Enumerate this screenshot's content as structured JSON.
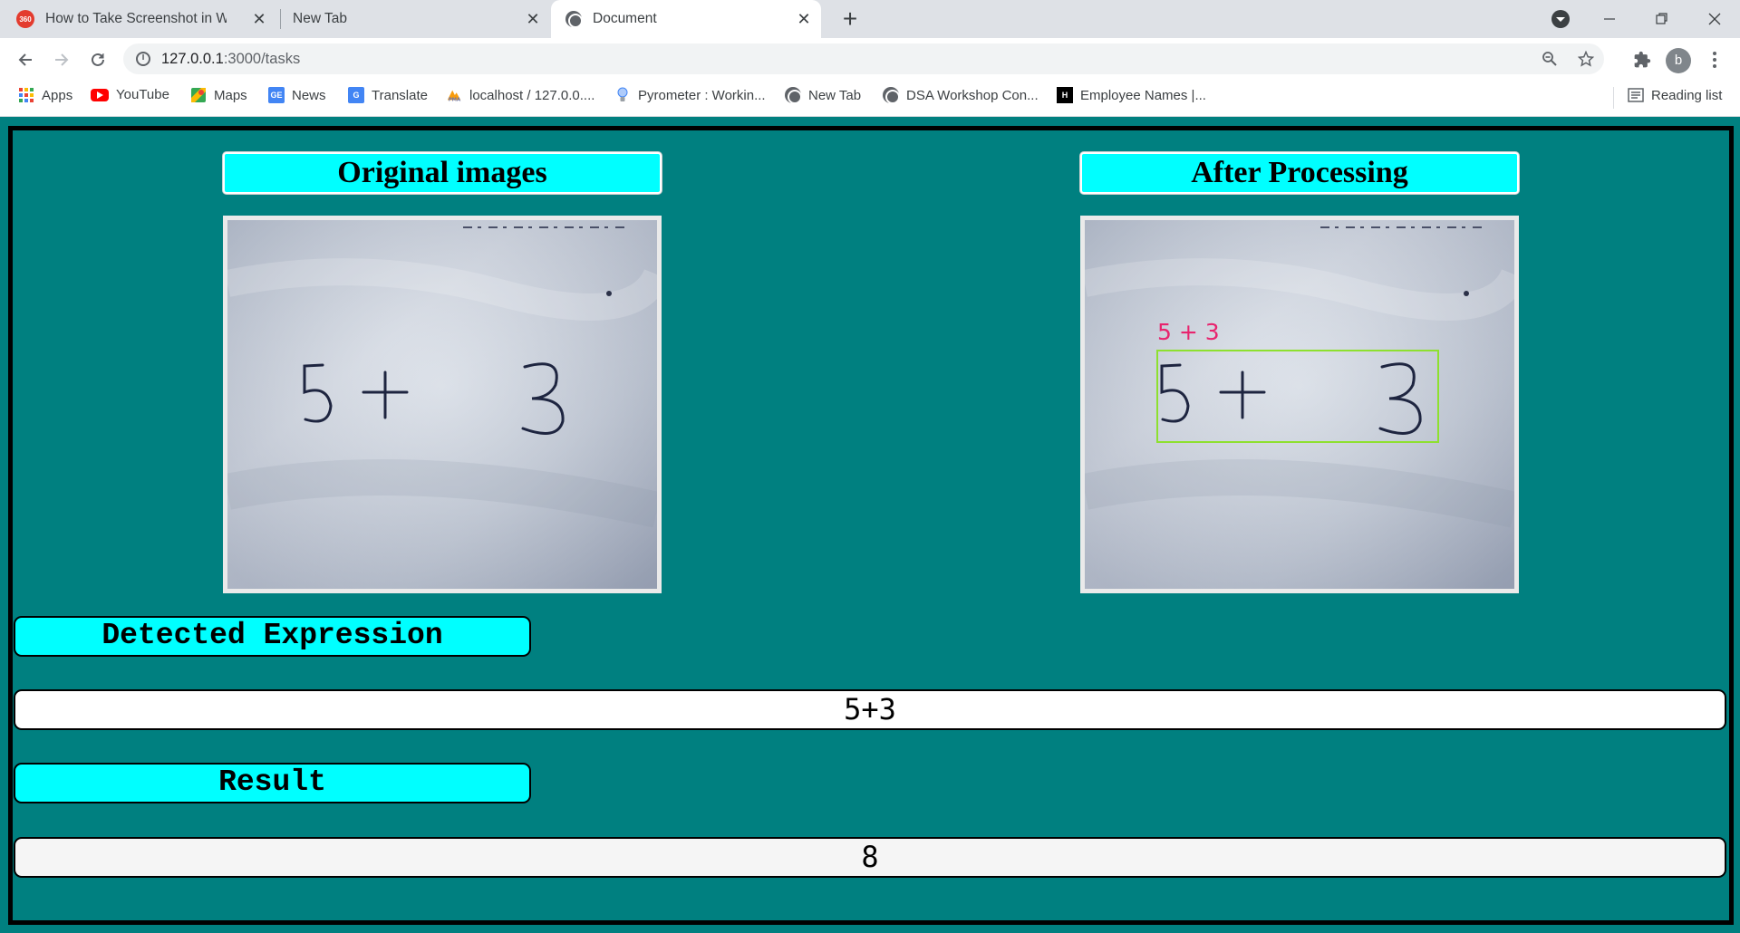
{
  "browser": {
    "tabs": [
      {
        "title": "How to Take Screenshot in Windows",
        "favicon": "360-logo-icon",
        "active": false
      },
      {
        "title": "New Tab",
        "favicon": "none",
        "active": false
      },
      {
        "title": "Document",
        "favicon": "globe-icon",
        "active": true
      }
    ],
    "tab_close_glyph": "✕",
    "new_tab_glyph": "+",
    "url_host": "127.0.0.1",
    "url_path": ":3000/tasks",
    "profile_initial": "b",
    "bookmarks": [
      {
        "label": "Apps",
        "icon": "apps-grid-icon"
      },
      {
        "label": "YouTube",
        "icon": "youtube-icon"
      },
      {
        "label": "Maps",
        "icon": "maps-icon"
      },
      {
        "label": "News",
        "icon": "news-icon"
      },
      {
        "label": "Translate",
        "icon": "translate-icon"
      },
      {
        "label": "localhost / 127.0.0....",
        "icon": "phpmyadmin-icon"
      },
      {
        "label": "Pyrometer : Workin...",
        "icon": "lightbulb-icon"
      },
      {
        "label": "New Tab",
        "icon": "globe-icon"
      },
      {
        "label": "DSA Workshop Con...",
        "icon": "globe-icon"
      },
      {
        "label": "Employee Names |...",
        "icon": "hackerrank-icon"
      }
    ],
    "reading_list": "Reading list"
  },
  "page": {
    "original_title": "Original images",
    "processed_title": "After Processing",
    "detection_label": "5 + 3",
    "detected_label": "Detected Expression",
    "detected_value": "5+3",
    "result_label": "Result",
    "result_value": "8",
    "handwriting": [
      "5",
      "+",
      "3"
    ]
  },
  "colors": {
    "page_bg": "#008080",
    "header_bg": "#00ffff",
    "detection_box": "#8ee02f",
    "detection_text": "#e8246e",
    "expr_box_bg": "#ffffff",
    "result_box_bg": "#f5f5f5"
  }
}
